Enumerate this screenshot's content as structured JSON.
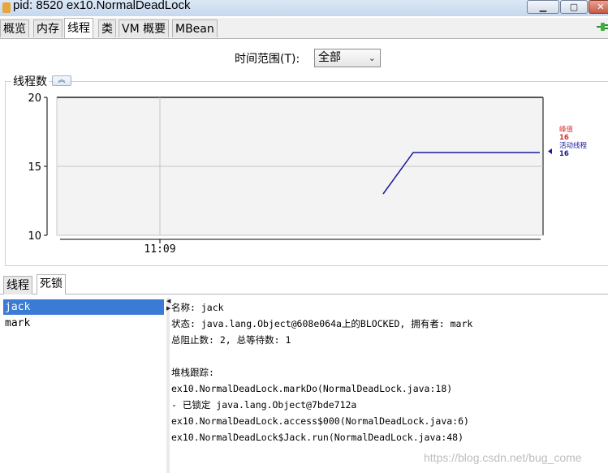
{
  "window": {
    "title": "pid: 8520 ex10.NormalDeadLock",
    "controls": {
      "minimize": "▁",
      "maximize": "▢",
      "close": "✕"
    }
  },
  "tabs": [
    "概览",
    "内存",
    "线程",
    "类",
    "VM 概要",
    "MBean"
  ],
  "active_tab": "线程",
  "time_range": {
    "label": "时间范围(T):",
    "selected": "全部"
  },
  "chart_panel": {
    "title": "线程数",
    "collapse_glyph": "︽"
  },
  "chart_data": {
    "type": "line",
    "y_ticks": [
      10,
      15,
      20
    ],
    "ylim": [
      10,
      20
    ],
    "x_tick_labels": [
      "11:09"
    ],
    "series": [
      {
        "name": "峰值",
        "color": "#d83030",
        "current": 16
      },
      {
        "name": "活动线程",
        "color": "#1a1a9a",
        "current": 16,
        "points": [
          13,
          16,
          16
        ]
      }
    ]
  },
  "bottom_tabs": [
    "线程",
    "死锁"
  ],
  "active_bottom_tab": "死锁",
  "threads": [
    "jack",
    "mark"
  ],
  "selected_thread": "jack",
  "details": [
    "名称: jack",
    "状态: java.lang.Object@608e064a上的BLOCKED, 拥有者: mark",
    "总阻止数: 2, 总等待数: 1",
    "",
    "堆栈跟踪:",
    "ex10.NormalDeadLock.markDo(NormalDeadLock.java:18)",
    "   - 已锁定 java.lang.Object@7bde712a",
    "ex10.NormalDeadLock.access$000(NormalDeadLock.java:6)",
    "ex10.NormalDeadLock$Jack.run(NormalDeadLock.java:48)"
  ],
  "watermark": "https://blog.csdn.net/bug_come",
  "colors": {
    "selection": "#3a7bd5",
    "plot_line": "#1a1a9a",
    "peak": "#d83030"
  }
}
